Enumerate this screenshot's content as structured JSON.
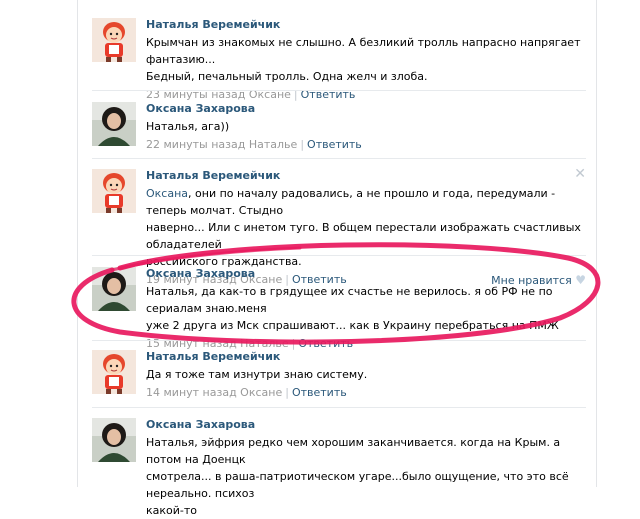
{
  "comments": [
    {
      "author": "Наталья Веремейчик",
      "avatar": "cartoon-avatar",
      "lines": [
        "Крымчан из знакомых не слышно. А безликий тролль напрасно напрягает фантазию...",
        "Бедный, печальный тролль. Одна желч и злоба."
      ],
      "time": "23 минуты назад Оксане",
      "reply": "Ответить"
    },
    {
      "author": "Оксана Захарова",
      "avatar": "photo-avatar",
      "lines": [
        "Наталья, ага))"
      ],
      "time": "22 минуты назад Наталье",
      "reply": "Ответить"
    },
    {
      "author": "Наталья Веремейчик",
      "avatar": "cartoon-avatar",
      "mention": "Оксана",
      "lines": [
        ", они по началу радовались, а не прошло и года, передумали - теперь молчат. Стыдно",
        "наверно... Или с инетом туго. В общем перестали изображать счастливых обладателей",
        "российского гражданства."
      ],
      "time": "19 минут назад Оксане",
      "reply": "Ответить",
      "like": "Мне нравится",
      "close": "✕"
    },
    {
      "author": "Оксана Захарова",
      "avatar": "photo-avatar",
      "lines": [
        "Наталья, да как-то в грядущее их счастье не верилось. я об РФ не по сериалам знаю.меня",
        "уже 2 друга из Мск спрашивают... как в Украину перебраться на ПМЖ"
      ],
      "time": "15 минут назад Наталье",
      "reply": "Ответить"
    },
    {
      "author": "Наталья Веремейчик",
      "avatar": "cartoon-avatar",
      "lines": [
        "Да я тоже там изнутри знаю систему."
      ],
      "time": "14 минут назад Оксане",
      "reply": "Ответить"
    },
    {
      "author": "Оксана Захарова",
      "avatar": "photo-avatar",
      "lines": [
        "Наталья, эйфрия редко чем хорошим заканчивается. когда на Крым. а потом на Доенцк",
        "смотрела... в раша-патриотическом угаре...было ощущение, что это всё нереально. психоз",
        "какой-то"
      ],
      "time": "",
      "reply": ""
    }
  ],
  "colors": {
    "link": "#2b587a",
    "meta": "#999999",
    "annotation_oval": "#e8195e"
  }
}
